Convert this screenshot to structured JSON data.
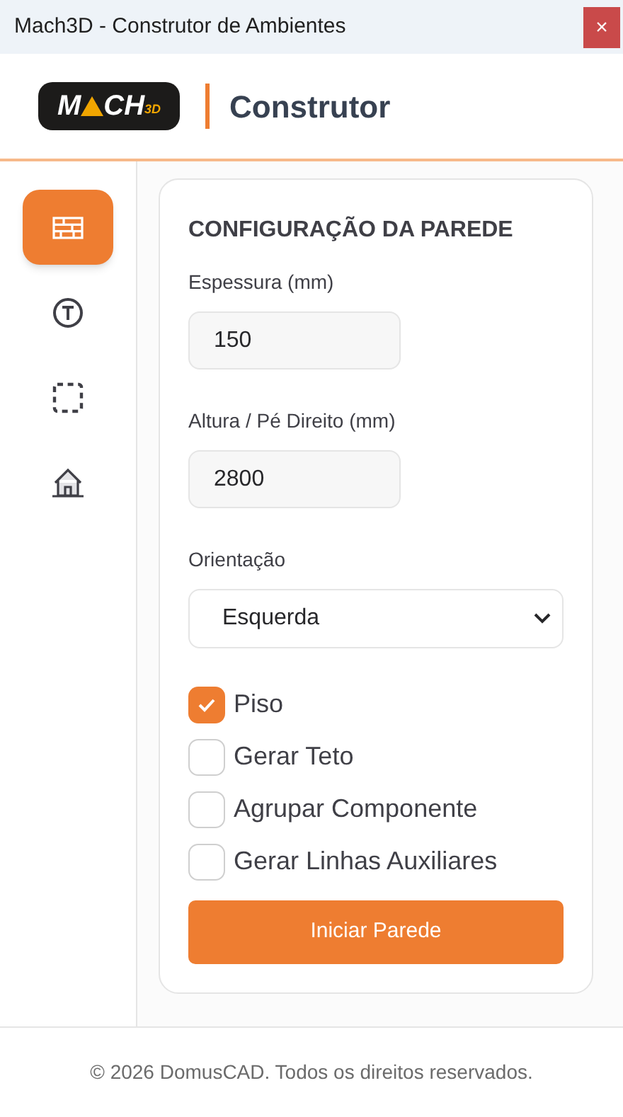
{
  "window": {
    "title": "Mach3D - Construtor de Ambientes",
    "close": "×"
  },
  "header": {
    "logo": {
      "left": "M",
      "right": "CH",
      "suffix": "3D"
    },
    "title": "Construtor"
  },
  "sidebar": {
    "items": [
      {
        "kind": "wall",
        "selected": true
      },
      {
        "kind": "tool",
        "selected": false
      },
      {
        "kind": "area",
        "selected": false
      },
      {
        "kind": "house",
        "selected": false
      }
    ]
  },
  "card": {
    "title": "CONFIGURAÇÃO DA PAREDE",
    "fields": [
      {
        "label": "Espessura (mm)",
        "value": "150"
      },
      {
        "label": "Altura / Pé Direito (mm)",
        "value": "2800"
      }
    ],
    "select": {
      "label": "Orientação",
      "value": "Esquerda"
    },
    "checkboxes": [
      {
        "label": "Piso",
        "checked": true
      },
      {
        "label": "Gerar Teto",
        "checked": false
      },
      {
        "label": "Agrupar Componente",
        "checked": false
      },
      {
        "label": "Gerar Linhas Auxiliares",
        "checked": false
      }
    ],
    "button": "Iniciar Parede"
  },
  "footer": "© 2026 DomusCAD. Todos os direitos reservados."
}
